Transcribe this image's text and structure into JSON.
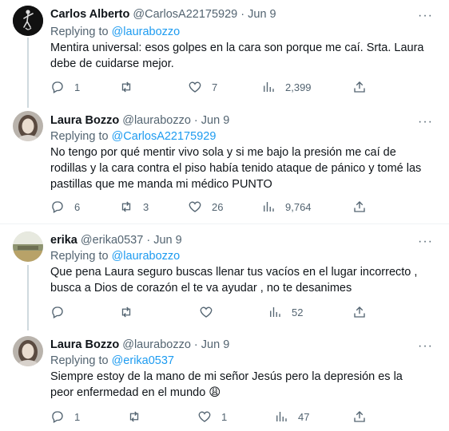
{
  "tweets": [
    {
      "name": "Carlos Alberto",
      "handle": "@CarlosA22175929",
      "separator": "·",
      "date": "Jun 9",
      "replying_prefix": "Replying to",
      "replying_to": "@laurabozzo",
      "text": "Mentira universal: esos golpes en la cara son porque me caí. Srta. Laura debe de cuidarse mejor.",
      "replies": "1",
      "retweets": "",
      "likes": "7",
      "views": "2,399",
      "avatar": "dancer-silhouette-avatar"
    },
    {
      "name": "Laura Bozzo",
      "handle": "@laurabozzo",
      "separator": "·",
      "date": "Jun 9",
      "replying_prefix": "Replying to",
      "replying_to": "@CarlosA22175929",
      "text": "No tengo por qué mentir vivo sola y si me bajo la presión me caí de rodillas y la cara contra el piso había tenido ataque de pánico y tomé las pastillas que me manda mi médico PUNTO",
      "replies": "6",
      "retweets": "3",
      "likes": "26",
      "views": "9,764",
      "avatar": "woman-portrait-avatar"
    },
    {
      "name": "erika",
      "handle": "@erika0537",
      "separator": "·",
      "date": "Jun 9",
      "replying_prefix": "Replying to",
      "replying_to": "@laurabozzo",
      "text": "Que pena Laura seguro buscas llenar tus vacíos en el lugar incorrecto , busca a Dios de corazón el te va ayudar , no te desanimes",
      "replies": "",
      "retweets": "",
      "likes": "",
      "views": "52",
      "avatar": "landscape-photo-avatar"
    },
    {
      "name": "Laura Bozzo",
      "handle": "@laurabozzo",
      "separator": "·",
      "date": "Jun 9",
      "replying_prefix": "Replying to",
      "replying_to": "@erika0537",
      "text": "Siempre estoy de la mano de mi señor Jesús pero la depresión es la peor enfermedad en el mundo 😩",
      "replies": "1",
      "retweets": "",
      "likes": "1",
      "views": "47",
      "avatar": "woman-portrait-avatar"
    }
  ],
  "colors": {
    "text": "#0f1419",
    "secondary": "#536471",
    "link": "#1d9bf0",
    "thread_line": "#cfd9de",
    "divider": "#eff3f4"
  },
  "icons": {
    "reply": "speech-bubble-icon",
    "retweet": "retweet-arrows-icon",
    "like": "heart-icon",
    "views": "bar-chart-icon",
    "share": "share-upload-icon",
    "more": "more-dots-icon"
  }
}
